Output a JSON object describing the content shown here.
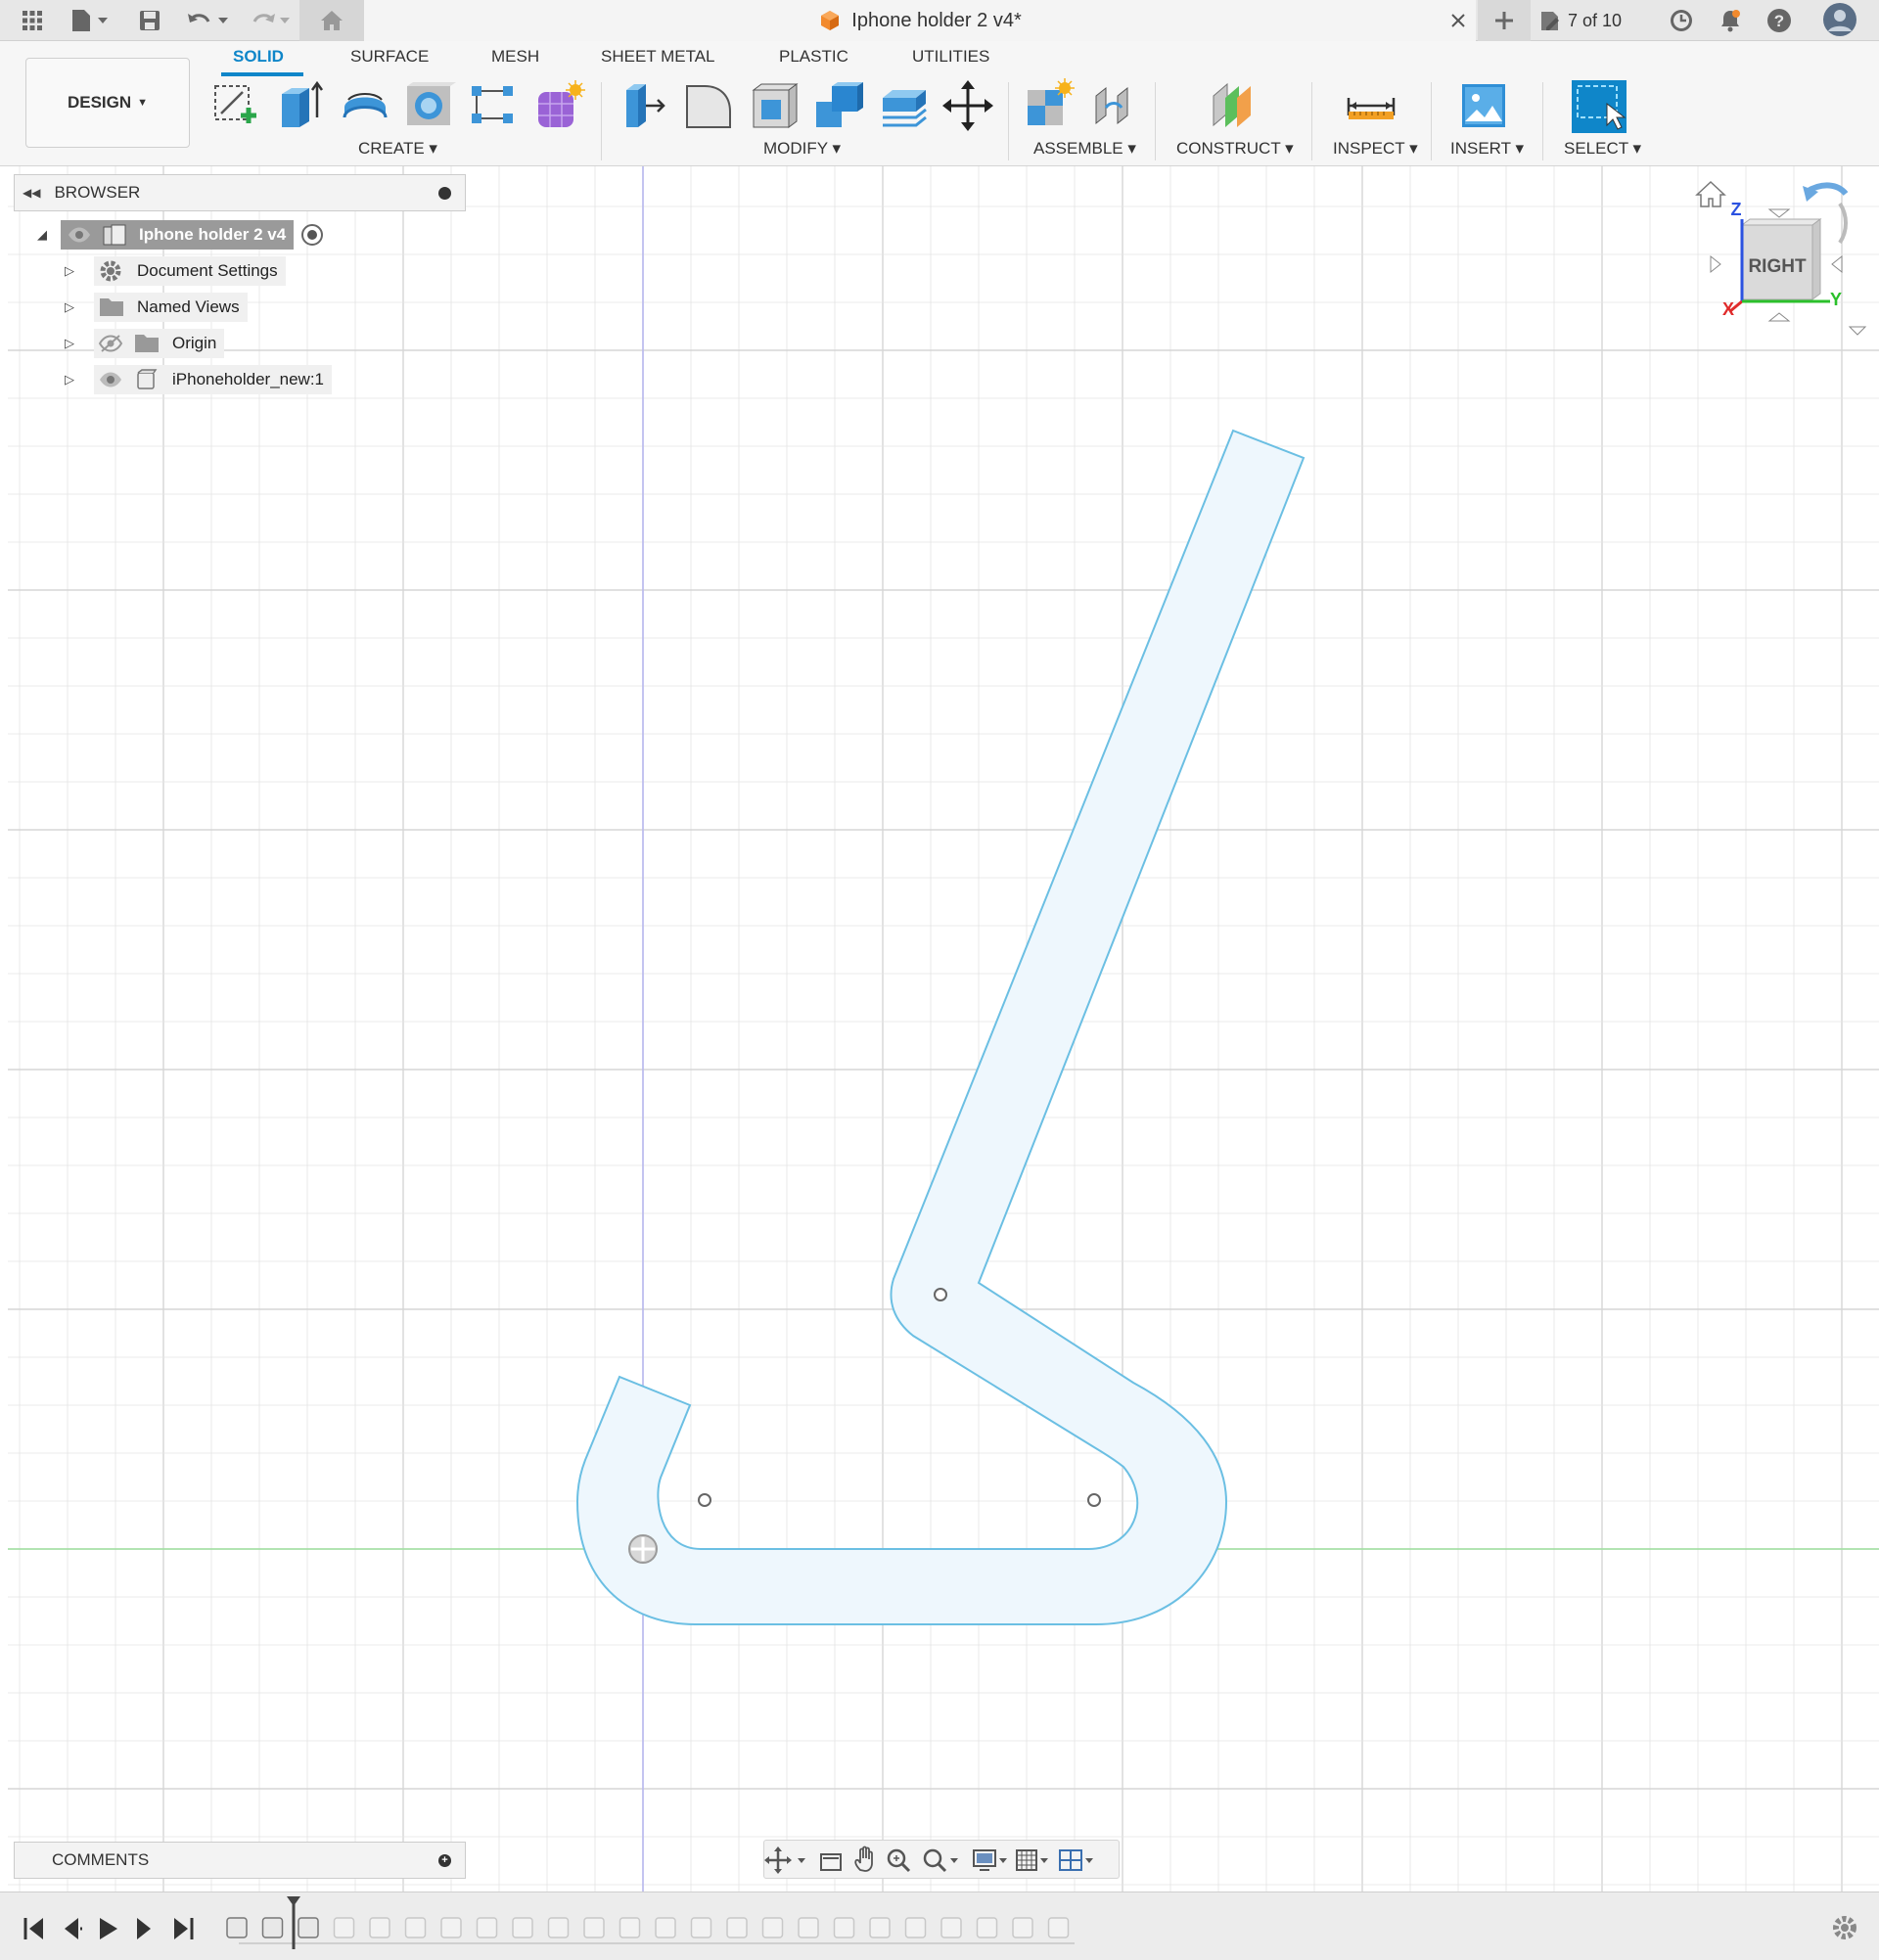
{
  "titlebar": {
    "doc_title": "Iphone holder 2 v4*",
    "version_counter": "7 of 10"
  },
  "ribbon": {
    "workspace": "DESIGN",
    "tabs": [
      "SOLID",
      "SURFACE",
      "MESH",
      "SHEET METAL",
      "PLASTIC",
      "UTILITIES"
    ],
    "active_tab": "SOLID",
    "groups": [
      "CREATE",
      "MODIFY",
      "ASSEMBLE",
      "CONSTRUCT",
      "INSPECT",
      "INSERT",
      "SELECT"
    ]
  },
  "browser": {
    "title": "BROWSER",
    "root": "Iphone holder 2 v4",
    "items": [
      "Document Settings",
      "Named Views",
      "Origin",
      "iPhoneholder_new:1"
    ]
  },
  "comments": {
    "title": "COMMENTS"
  },
  "viewcube": {
    "face": "RIGHT",
    "axes": [
      "Z",
      "X",
      "Y"
    ]
  },
  "colors": {
    "accent": "#0f86c9",
    "sketch_fill": "#eef7fd",
    "sketch_stroke": "#6bbfe3",
    "grid": "#e4e4e4",
    "grid_major": "#d6d6d6",
    "x_axis": "#9fe19f",
    "z_axis": "#b6b6f0"
  }
}
